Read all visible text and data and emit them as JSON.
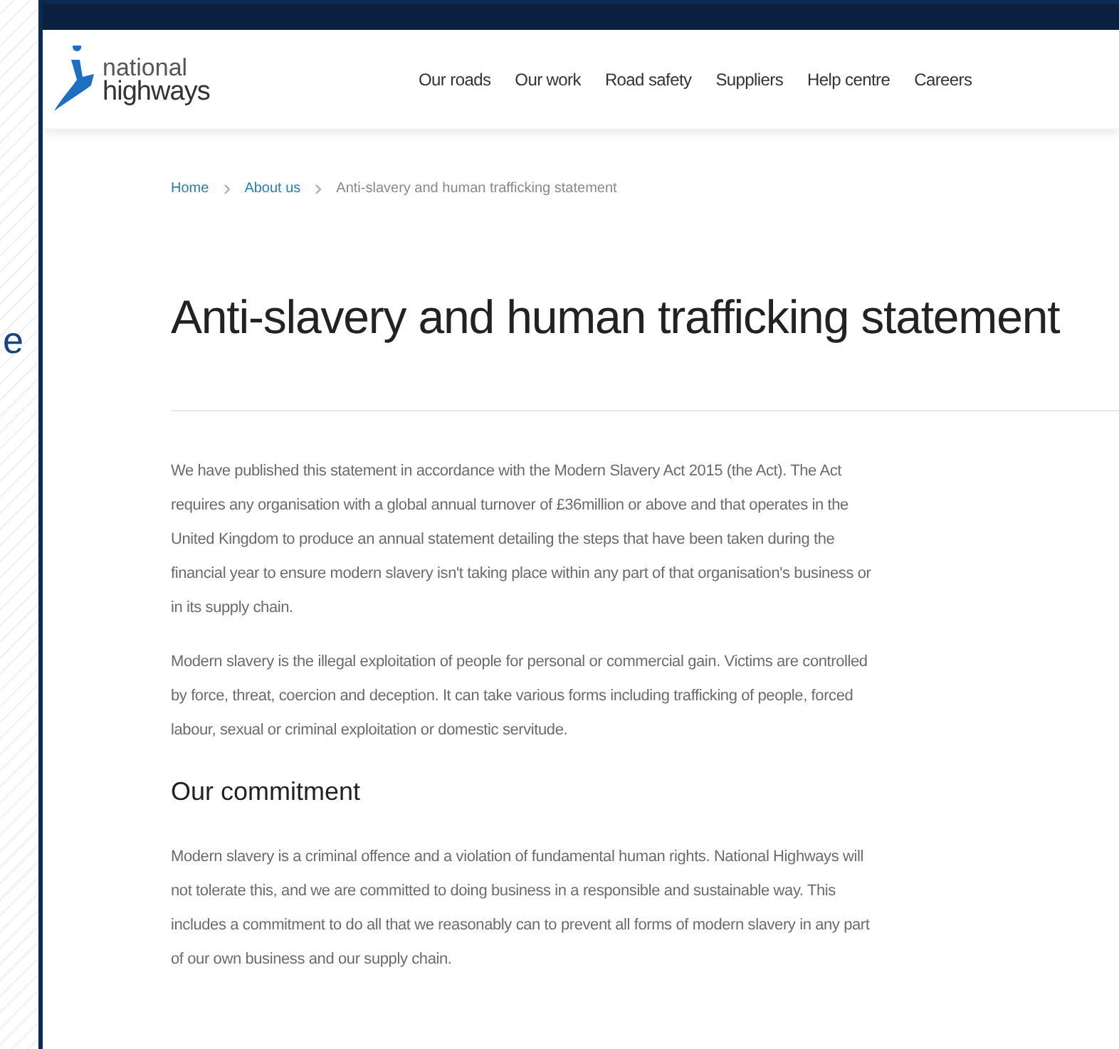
{
  "side_fragment": "e",
  "logo": {
    "line_1": "national",
    "line_2": "highways"
  },
  "nav": [
    "Our roads",
    "Our work",
    "Road safety",
    "Suppliers",
    "Help centre",
    "Careers"
  ],
  "breadcrumb": [
    {
      "label": "Home",
      "kind": "link"
    },
    {
      "label": "About us",
      "kind": "link"
    },
    {
      "label": "Anti-slavery and human trafficking statement",
      "kind": "current"
    }
  ],
  "title": "Anti-slavery and human trafficking statement",
  "sections": [
    {
      "kind": "paragraph",
      "text": "We have published this statement in accordance with the Modern Slavery Act 2015 (the Act). The Act requires any organisation with a global annual turnover of £36million or above and that operates in the United Kingdom to produce an annual statement detailing the steps that have been taken during the financial year to ensure modern slavery isn't taking place within any part of that organisation's business or in its supply chain."
    },
    {
      "kind": "paragraph",
      "text": "Modern slavery is the illegal exploitation of people for personal or commercial gain. Victims are controlled by force, threat, coercion and deception. It can take various forms including trafficking of people, forced labour, sexual or criminal exploitation or domestic servitude."
    },
    {
      "kind": "heading",
      "text": "Our commitment"
    },
    {
      "kind": "paragraph",
      "text": "Modern slavery is a criminal offence and a violation of fundamental human rights. National Highways will not tolerate this, and we are committed to doing business in a responsible and sustainable way. This includes a commitment to do all that we reasonably can to prevent all forms of modern slavery in any part of our own business and our supply chain."
    }
  ]
}
